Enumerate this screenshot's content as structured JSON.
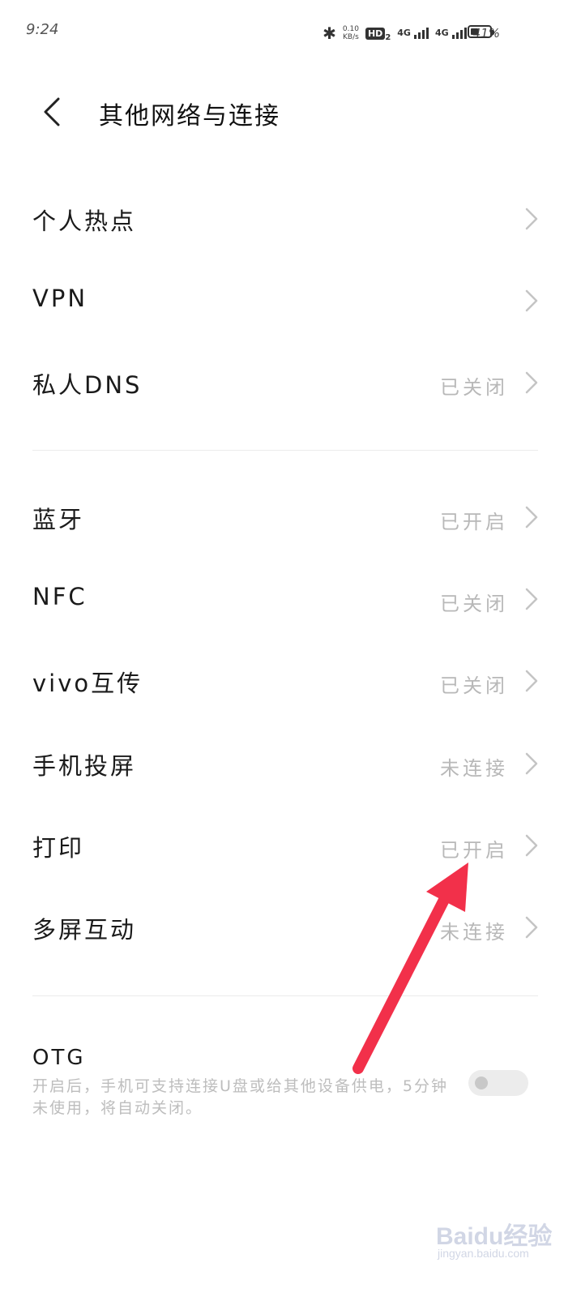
{
  "status_bar": {
    "time": "9:24",
    "speed_value": "0.10",
    "speed_unit": "KB/s",
    "hd_label": "HD",
    "hd_sub": "2",
    "network1": "4G",
    "network2": "4G",
    "battery_percent": "41%",
    "battery_level": 0.41
  },
  "header": {
    "title": "其他网络与连接"
  },
  "settings": [
    {
      "label": "个人热点",
      "value": ""
    },
    {
      "label": "VPN",
      "value": ""
    },
    {
      "label": "私人DNS",
      "value": "已关闭"
    },
    {
      "label": "蓝牙",
      "value": "已开启"
    },
    {
      "label": "NFC",
      "value": "已关闭"
    },
    {
      "label": "vivo互传",
      "value": "已关闭"
    },
    {
      "label": "手机投屏",
      "value": "未连接"
    },
    {
      "label": "打印",
      "value": "已开启"
    },
    {
      "label": "多屏互动",
      "value": "未连接"
    }
  ],
  "otg": {
    "title": "OTG",
    "description": "开启后，手机可支持连接U盘或给其他设备供电，5分钟未使用，将自动关闭。",
    "enabled": false
  },
  "annotation": {
    "color": "#f2304a"
  },
  "watermark": {
    "brand": "Baidu经验",
    "url": "jingyan.baidu.com"
  }
}
